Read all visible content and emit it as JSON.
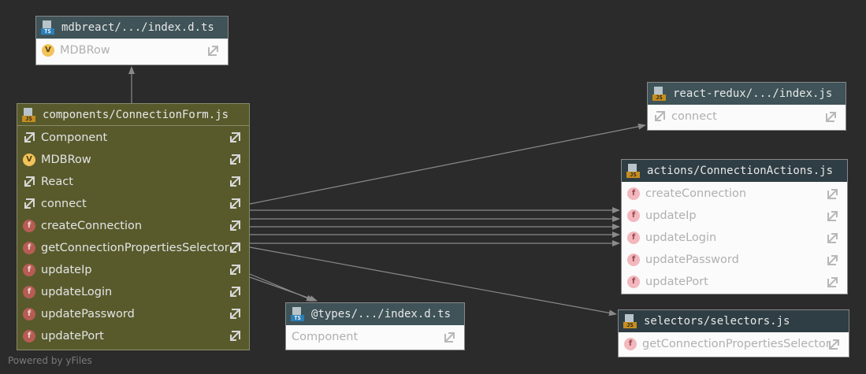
{
  "nodes": {
    "mdbreact": {
      "title": "mdbreact/.../index.d.ts",
      "file_type": "TS",
      "rows": [
        "MDBRow"
      ]
    },
    "connection_form": {
      "title": "components/ConnectionForm.js",
      "file_type": "JS",
      "rows": [
        "Component",
        "MDBRow",
        "React",
        "connect",
        "createConnection",
        "getConnectionPropertiesSelector",
        "updateIp",
        "updateLogin",
        "updatePassword",
        "updatePort"
      ]
    },
    "react_redux": {
      "title": "react-redux/.../index.js",
      "file_type": "JS",
      "rows": [
        "connect"
      ]
    },
    "connection_actions": {
      "title": "actions/ConnectionActions.js",
      "file_type": "JS",
      "rows": [
        "createConnection",
        "updateIp",
        "updateLogin",
        "updatePassword",
        "updatePort"
      ]
    },
    "types": {
      "title": "@types/.../index.d.ts",
      "file_type": "TS",
      "rows": [
        "Component"
      ]
    },
    "selectors": {
      "title": "selectors/selectors.js",
      "file_type": "JS",
      "rows": [
        "getConnectionPropertiesSelector"
      ]
    }
  },
  "badges": {
    "function": "f",
    "variable": "V"
  },
  "footer": "Powered by yFiles"
}
